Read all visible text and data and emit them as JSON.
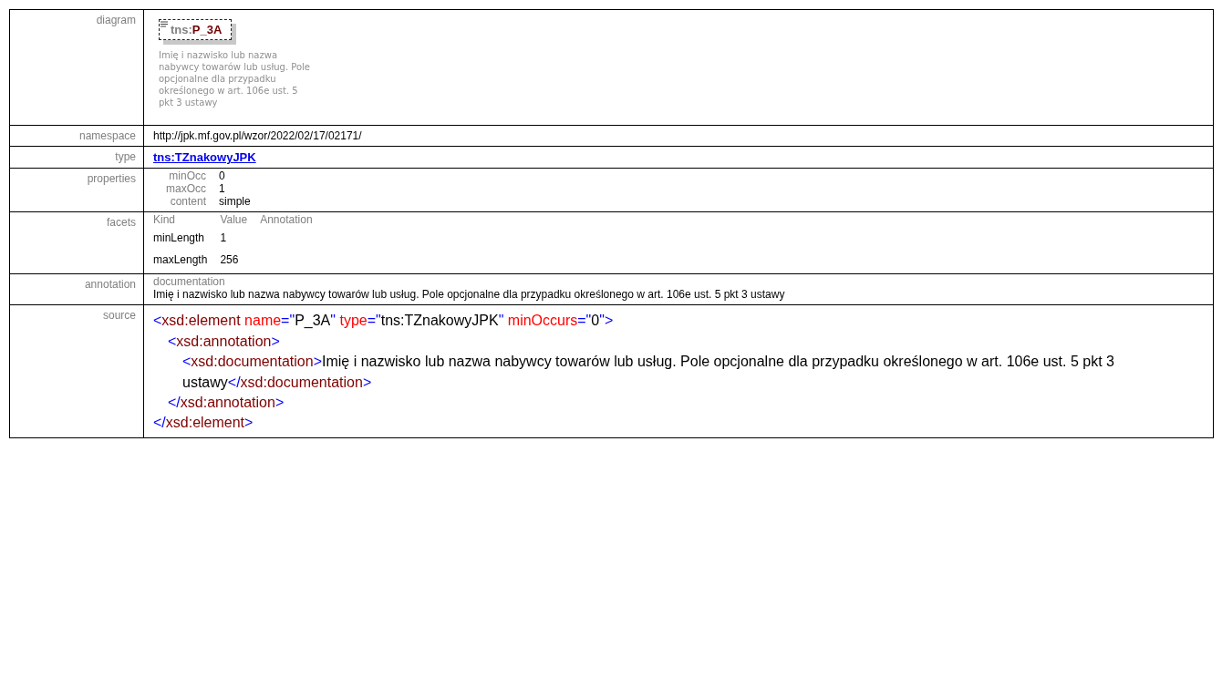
{
  "rows": [
    {
      "label": "diagram",
      "kind": "diagram",
      "diagram": {
        "prefix": "tns:",
        "name": "P_3A",
        "description": "Imię i nazwisko lub nazwa nabywcy towarów lub usług. Pole opcjonalne dla przypadku określonego w art. 106e ust. 5 pkt 3 ustawy"
      }
    },
    {
      "label": "namespace",
      "kind": "text",
      "value": "http://jpk.mf.gov.pl/wzor/2022/02/17/02171/"
    },
    {
      "label": "type",
      "kind": "link",
      "value": "tns:TZnakowyJPK"
    },
    {
      "label": "properties",
      "kind": "properties",
      "items": [
        {
          "name": "minOcc",
          "value": "0"
        },
        {
          "name": "maxOcc",
          "value": "1"
        },
        {
          "name": "content",
          "value": "simple"
        }
      ]
    },
    {
      "label": "facets",
      "kind": "facets",
      "columns": [
        "Kind",
        "Value",
        "Annotation"
      ],
      "items": [
        {
          "kind": "minLength",
          "value": "1"
        },
        {
          "kind": "maxLength",
          "value": "256"
        }
      ]
    },
    {
      "label": "annotation",
      "kind": "annotation",
      "heading": "documentation",
      "text": "Imię i nazwisko lub nazwa nabywcy towarów lub usług. Pole opcjonalne dla przypadku określonego w art. 106e ust. 5 pkt 3 ustawy"
    },
    {
      "label": "source",
      "kind": "source",
      "nodes": [
        {
          "open": [
            {
              "kind": "bracket",
              "text": "<"
            },
            {
              "kind": "tag",
              "text": "xsd:element"
            },
            {
              "kind": "attr",
              "text": "name"
            },
            {
              "kind": "bracket",
              "text": "=\""
            },
            {
              "kind": "value",
              "text": "P_3A"
            },
            {
              "kind": "bracket",
              "text": "\""
            },
            {
              "kind": "attr",
              "text": "type"
            },
            {
              "kind": "bracket",
              "text": "=\""
            },
            {
              "kind": "value",
              "text": "tns:TZnakowyJPK"
            },
            {
              "kind": "bracket",
              "text": "\""
            },
            {
              "kind": "attr",
              "text": "minOccurs"
            },
            {
              "kind": "bracket",
              "text": "=\""
            },
            {
              "kind": "value",
              "text": "0"
            },
            {
              "kind": "bracket",
              "text": "\">"
            }
          ],
          "children": [
            {
              "open": [
                {
                  "kind": "bracket",
                  "text": "<"
                },
                {
                  "kind": "tag",
                  "text": "xsd:annotation"
                },
                {
                  "kind": "bracket",
                  "text": ">"
                }
              ],
              "children": [
                {
                  "open": [
                    {
                      "kind": "bracket",
                      "text": "<"
                    },
                    {
                      "kind": "tag",
                      "text": "xsd:documentation"
                    },
                    {
                      "kind": "bracket",
                      "text": ">"
                    },
                    {
                      "kind": "value",
                      "text": "Imię i nazwisko lub nazwa nabywcy towarów lub usług. Pole opcjonalne dla przypadku określonego w art. 106e ust. 5 pkt 3 ustawy"
                    },
                    {
                      "kind": "bracket",
                      "text": "</"
                    },
                    {
                      "kind": "tag",
                      "text": "xsd:documentation"
                    },
                    {
                      "kind": "bracket",
                      "text": ">"
                    }
                  ]
                }
              ],
              "close": [
                {
                  "kind": "bracket",
                  "text": "</"
                },
                {
                  "kind": "tag",
                  "text": "xsd:annotation"
                },
                {
                  "kind": "bracket",
                  "text": ">"
                }
              ]
            }
          ],
          "close": [
            {
              "kind": "bracket",
              "text": "</"
            },
            {
              "kind": "tag",
              "text": "xsd:element"
            },
            {
              "kind": "bracket",
              "text": ">"
            }
          ]
        }
      ]
    }
  ]
}
